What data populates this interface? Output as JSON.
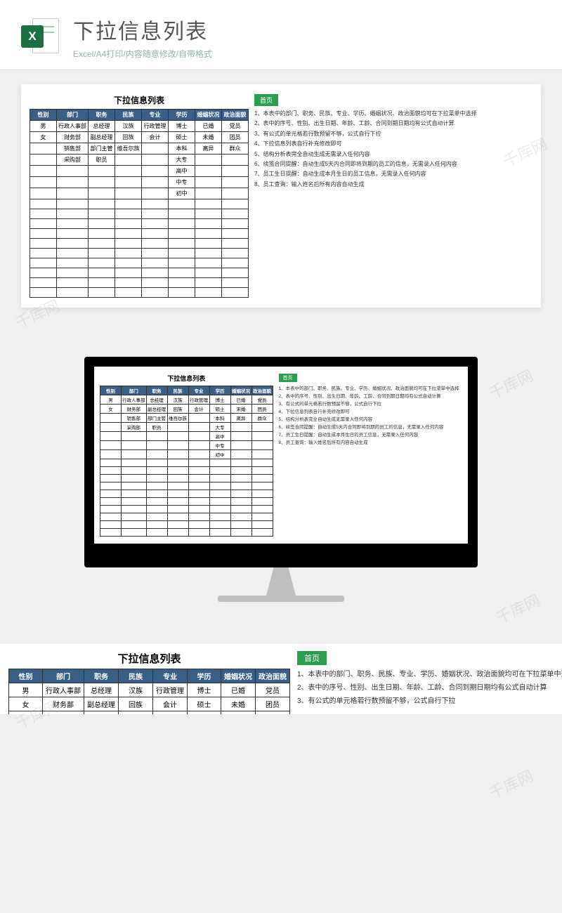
{
  "header": {
    "icon_letter": "X",
    "title": "下拉信息列表",
    "subtitle": "Excel/A4打印/内容随意修改/自带格式"
  },
  "watermark": "千库网",
  "sheet": {
    "title": "下拉信息列表",
    "home_button": "首页",
    "columns": [
      "性别",
      "部门",
      "职务",
      "民族",
      "专业",
      "学历",
      "婚姻状况",
      "政治面貌"
    ],
    "rows": [
      [
        "男",
        "行政人事部",
        "总经理",
        "汉族",
        "行政管理",
        "博士",
        "已婚",
        "党员"
      ],
      [
        "女",
        "财务部",
        "副总经理",
        "回族",
        "会计",
        "硕士",
        "未婚",
        "团员"
      ],
      [
        "",
        "销售部",
        "部门主管",
        "维吾尔族",
        "",
        "本科",
        "离异",
        "群众"
      ],
      [
        "",
        "采购部",
        "职员",
        "",
        "",
        "大专",
        "",
        ""
      ],
      [
        "",
        "",
        "",
        "",
        "",
        "高中",
        "",
        ""
      ],
      [
        "",
        "",
        "",
        "",
        "",
        "中专",
        "",
        ""
      ],
      [
        "",
        "",
        "",
        "",
        "",
        "初中",
        "",
        ""
      ],
      [
        "",
        "",
        "",
        "",
        "",
        "",
        "",
        ""
      ],
      [
        "",
        "",
        "",
        "",
        "",
        "",
        "",
        ""
      ],
      [
        "",
        "",
        "",
        "",
        "",
        "",
        "",
        ""
      ],
      [
        "",
        "",
        "",
        "",
        "",
        "",
        "",
        ""
      ],
      [
        "",
        "",
        "",
        "",
        "",
        "",
        "",
        ""
      ],
      [
        "",
        "",
        "",
        "",
        "",
        "",
        "",
        ""
      ],
      [
        "",
        "",
        "",
        "",
        "",
        "",
        "",
        ""
      ],
      [
        "",
        "",
        "",
        "",
        "",
        "",
        "",
        ""
      ],
      [
        "",
        "",
        "",
        "",
        "",
        "",
        "",
        ""
      ],
      [
        "",
        "",
        "",
        "",
        "",
        "",
        "",
        ""
      ]
    ],
    "notes": [
      "1、本表中的部门、职务、民族、专业、学历、婚姻状况、政治面貌均可在下拉菜单中选择",
      "2、表中的序号、性别、出生日期、年龄、工龄、合同到期日期均有公式自动计算",
      "3、有公式的单元格若行数预留不够，公式自行下拉",
      "4、下拉信息列表自行补充修改即可",
      "5、结构分析表完全自动生成无需录入任何内容",
      "6、续签合同提醒：自动生成5天内合同即将到期的员工的信息，无需录入任何内容",
      "7、员工生日提醒：自动生成本月生日的员工信息，无需录入任何内容",
      "8、员工查询：输入姓名后所有内容自动生成"
    ]
  },
  "bottom_rows_visible": 3
}
